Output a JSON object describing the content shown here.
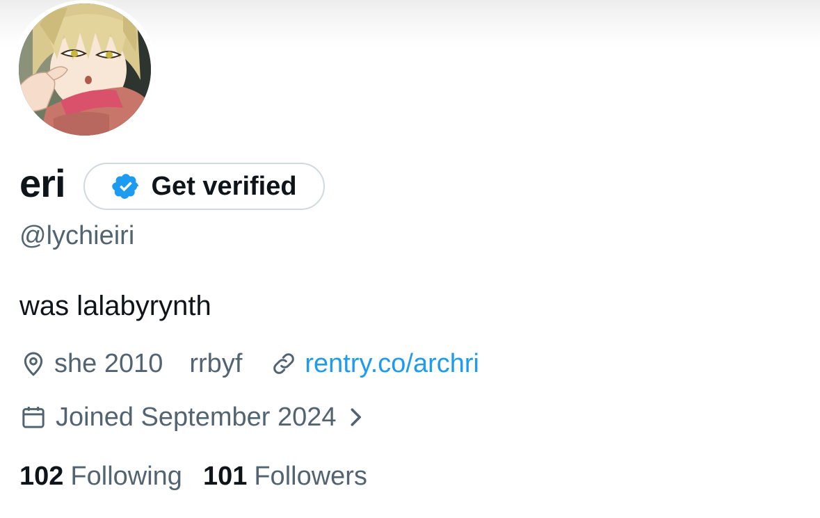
{
  "profile": {
    "display_name": "eri",
    "handle": "@lychieiri",
    "bio": "was lalabyrynth",
    "avatar_icon": "anime-character-avatar"
  },
  "verify_button": {
    "label": "Get verified",
    "badge_icon": "verified-badge-icon",
    "badge_color": "#1d9bf0"
  },
  "meta": {
    "location_icon": "location-pin-icon",
    "location": "she 2010",
    "extra": "rrbyf",
    "link_icon": "link-icon",
    "link": "rentry.co/archri",
    "link_color": "#1d9bf0"
  },
  "joined": {
    "calendar_icon": "calendar-icon",
    "text": "Joined September 2024",
    "chevron_icon": "chevron-right-icon"
  },
  "stats": {
    "following_count": "102",
    "following_label": "Following",
    "followers_count": "101",
    "followers_label": "Followers"
  },
  "colors": {
    "text_primary": "#0f1419",
    "text_secondary": "#536471",
    "accent": "#1d9bf0",
    "border": "#cfd9de"
  }
}
